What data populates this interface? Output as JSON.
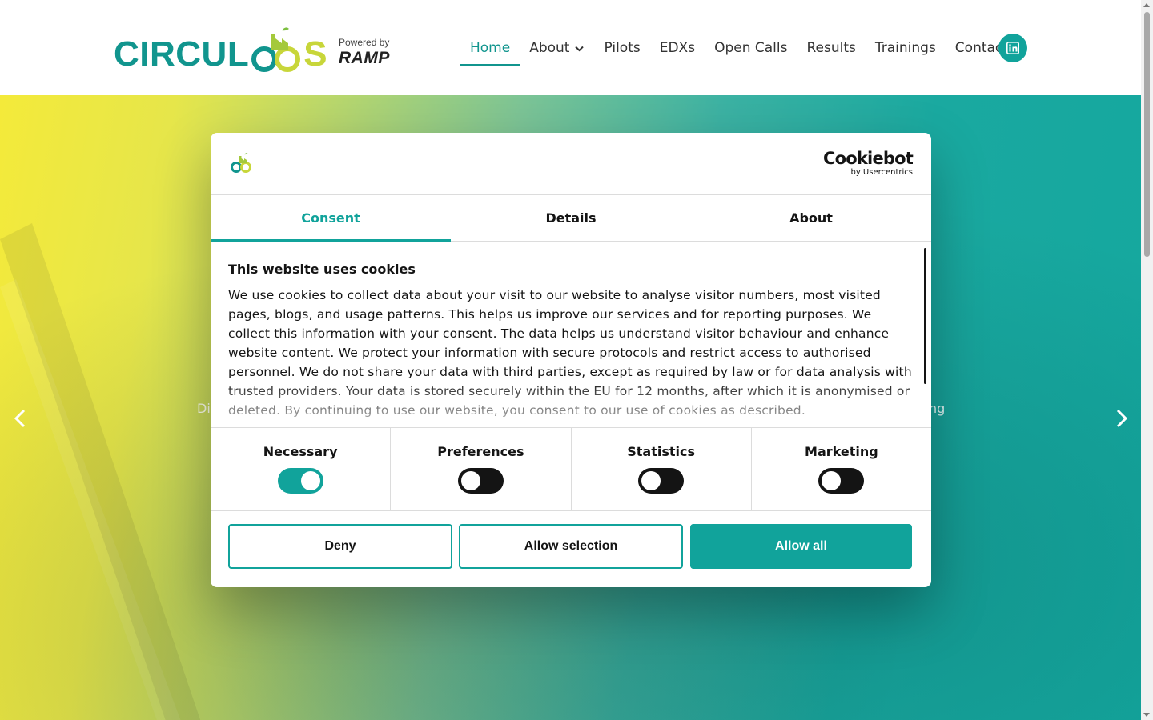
{
  "header": {
    "logo_text": "CIRCULOOS",
    "logo_part1": "CIRCUL",
    "logo_part2": "S",
    "powered_by": "Powered by",
    "powered_brand": "RAMP",
    "nav": [
      {
        "label": "Home",
        "active": true
      },
      {
        "label": "About",
        "dropdown": true
      },
      {
        "label": "Pilots"
      },
      {
        "label": "EDXs"
      },
      {
        "label": "Open Calls"
      },
      {
        "label": "Results"
      },
      {
        "label": "Trainings"
      },
      {
        "label": "Contact"
      }
    ],
    "social_icon": "linkedin-icon"
  },
  "hero": {
    "text_left_fragment": "Di",
    "text_right_fragment": "ng"
  },
  "cookie_dialog": {
    "brand": "Cookiebot",
    "brand_sub": "by Usercentrics",
    "tabs": [
      {
        "label": "Consent",
        "active": true
      },
      {
        "label": "Details"
      },
      {
        "label": "About"
      }
    ],
    "title": "This website uses cookies",
    "body": "We use cookies to collect data about your visit to our website to analyse visitor numbers, most visited pages, blogs, and usage patterns. This helps us improve our services and for reporting purposes. We collect this information with your consent. The data helps us understand visitor behaviour and enhance website content. We protect your information with secure protocols and restrict access to authorised personnel. We do not share your data with third parties, except as required by law or for data analysis with trusted providers. Your data is stored securely within the EU for 12 months, after which it is anonymised or deleted. By continuing to use our website, you consent to our use of cookies as described.",
    "toggles": [
      {
        "label": "Necessary",
        "state": "on"
      },
      {
        "label": "Preferences",
        "state": "off"
      },
      {
        "label": "Statistics",
        "state": "off"
      },
      {
        "label": "Marketing",
        "state": "off"
      }
    ],
    "buttons": {
      "deny": "Deny",
      "allow_selection": "Allow selection",
      "allow_all": "Allow all"
    }
  },
  "colors": {
    "accent": "#11a39b",
    "brand_teal": "#11958e",
    "brand_lime": "#c8d63a",
    "text": "#141414"
  }
}
